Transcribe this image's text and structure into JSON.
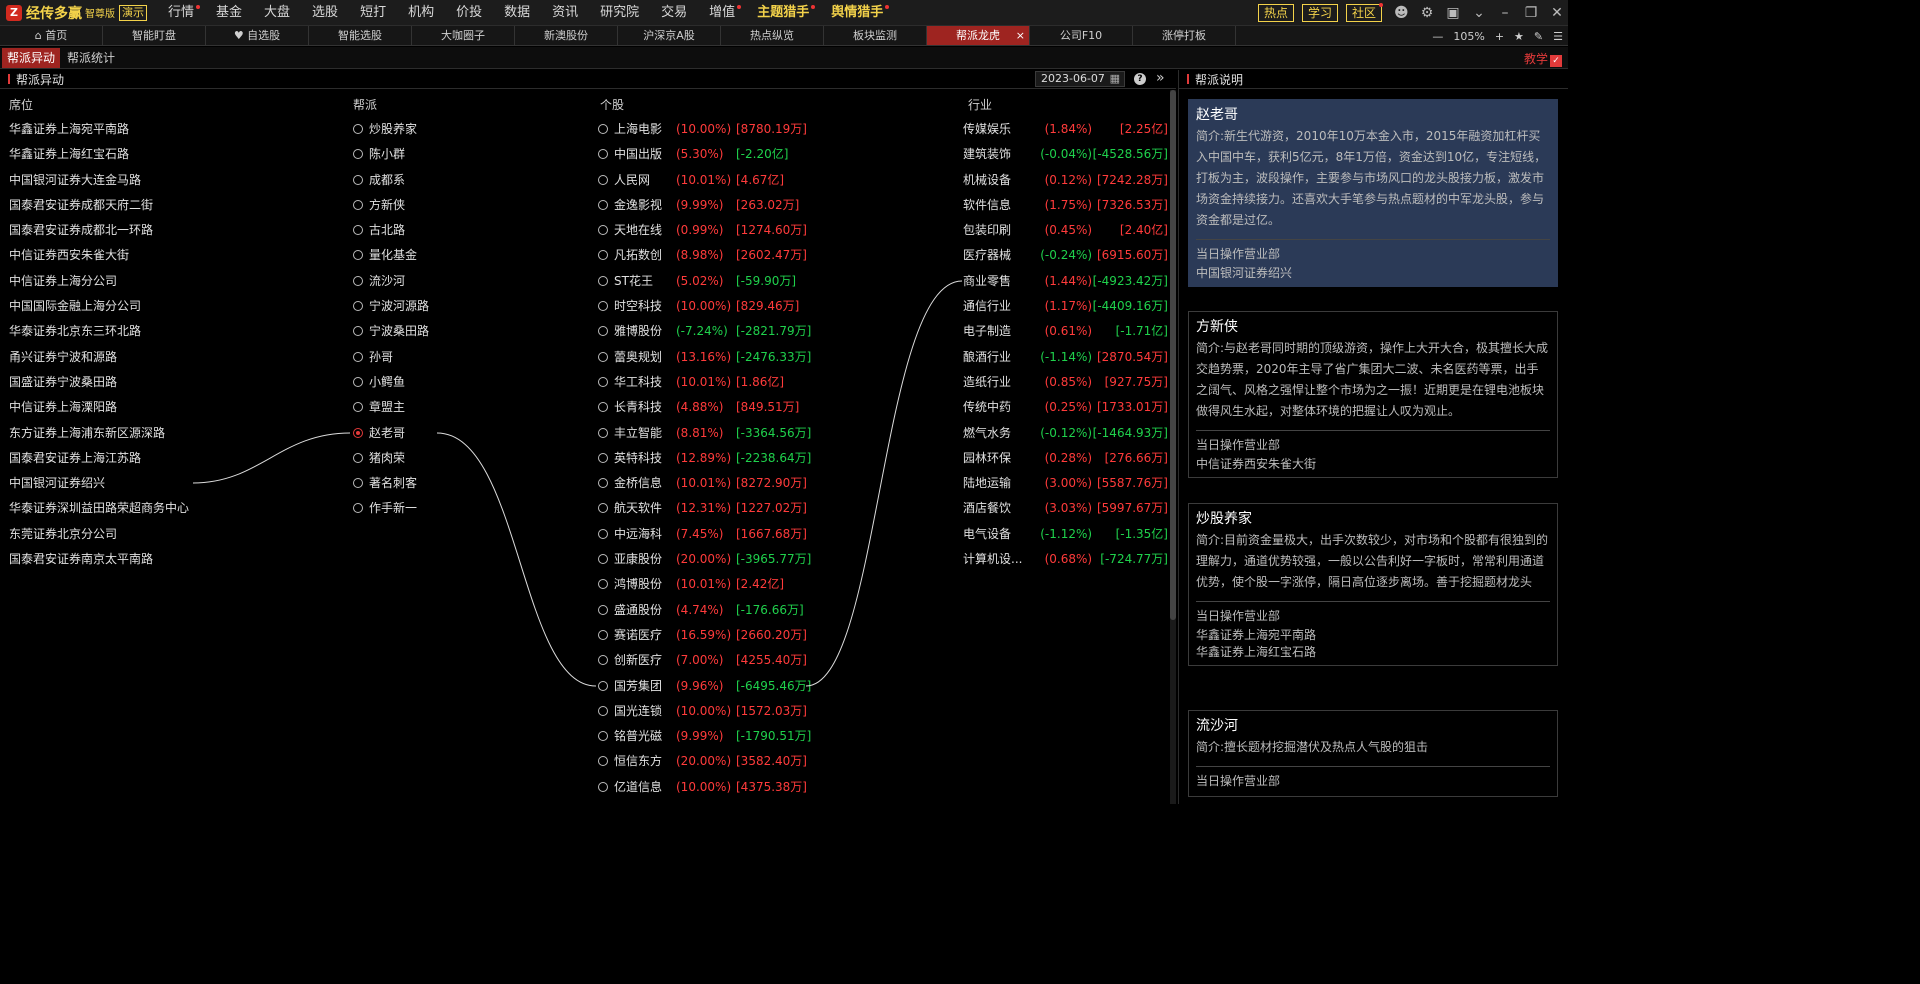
{
  "app": {
    "logo_text": "经传多赢",
    "edition": "智尊版",
    "demo_label": "演示",
    "menu": [
      {
        "label": "行情",
        "dot": true
      },
      {
        "label": "基金",
        "dot": false
      },
      {
        "label": "大盘",
        "dot": false
      },
      {
        "label": "选股",
        "dot": false
      },
      {
        "label": "短打",
        "dot": false
      },
      {
        "label": "机构",
        "dot": false
      },
      {
        "label": "价投",
        "dot": false
      },
      {
        "label": "数据",
        "dot": false
      },
      {
        "label": "资讯",
        "dot": false
      },
      {
        "label": "研究院",
        "dot": false
      },
      {
        "label": "交易",
        "dot": false
      },
      {
        "label": "增值",
        "dot": true
      },
      {
        "label": "主题猎手",
        "dot": true
      },
      {
        "label": "舆情猎手",
        "dot": true
      }
    ],
    "top_buttons": [
      "热点",
      "学习",
      "社区"
    ],
    "top_icons": [
      "user-icon",
      "gear-icon",
      "window-icon",
      "chevron-down-icon",
      "minimize-icon",
      "restore-icon",
      "close-icon"
    ]
  },
  "tabs": [
    {
      "label": "首页"
    },
    {
      "label": "智能盯盘"
    },
    {
      "label": "自选股"
    },
    {
      "label": "智能选股"
    },
    {
      "label": "大咖圈子"
    },
    {
      "label": "新澳股份"
    },
    {
      "label": "沪深京A股"
    },
    {
      "label": "热点纵览"
    },
    {
      "label": "板块监测"
    },
    {
      "label": "帮派龙虎",
      "active": true
    },
    {
      "label": "公司F10"
    },
    {
      "label": "涨停打板"
    }
  ],
  "zoom": {
    "minus": "—",
    "value": "105%",
    "plus": "+"
  },
  "subtabs": [
    "帮派异动",
    "帮派统计"
  ],
  "teach_label": "教学",
  "left_panel": {
    "title": "帮派异动",
    "date": "2023-06-07",
    "headers": {
      "seat": "席位",
      "faction": "帮派",
      "stock": "个股",
      "industry": "行业"
    },
    "seats": [
      "华鑫证券上海宛平南路",
      "华鑫证券上海红宝石路",
      "中国银河证券大连金马路",
      "国泰君安证券成都天府二街",
      "国泰君安证券成都北一环路",
      "中信证券西安朱雀大街",
      "中信证券上海分公司",
      "中国国际金融上海分公司",
      "华泰证券北京东三环北路",
      "甬兴证券宁波和源路",
      "国盛证券宁波桑田路",
      "中信证券上海溧阳路",
      "东方证券上海浦东新区源深路",
      "国泰君安证券上海江苏路",
      "中国银河证券绍兴",
      "华泰证券深圳益田路荣超商务中心",
      "东莞证券北京分公司",
      "国泰君安证券南京太平南路"
    ],
    "factions": [
      {
        "name": "炒股养家"
      },
      {
        "name": "陈小群"
      },
      {
        "name": "成都系"
      },
      {
        "name": "方新侠"
      },
      {
        "name": "古北路"
      },
      {
        "name": "量化基金"
      },
      {
        "name": "流沙河"
      },
      {
        "name": "宁波河源路"
      },
      {
        "name": "宁波桑田路"
      },
      {
        "name": "孙哥"
      },
      {
        "name": "小鳄鱼"
      },
      {
        "name": "章盟主"
      },
      {
        "name": "赵老哥",
        "selected": true
      },
      {
        "name": "猪肉荣"
      },
      {
        "name": "著名刺客"
      },
      {
        "name": "作手新一"
      }
    ],
    "stocks": [
      {
        "name": "上海电影",
        "pct": "(10.00%)",
        "amt": "[8780.19万]",
        "pc": "red",
        "ac": "red"
      },
      {
        "name": "中国出版",
        "pct": "(5.30%)",
        "amt": "[-2.20亿]",
        "pc": "red",
        "ac": "green"
      },
      {
        "name": "人民网",
        "pct": "(10.01%)",
        "amt": "[4.67亿]",
        "pc": "red",
        "ac": "red"
      },
      {
        "name": "金逸影视",
        "pct": "(9.99%)",
        "amt": "[263.02万]",
        "pc": "red",
        "ac": "red"
      },
      {
        "name": "天地在线",
        "pct": "(0.99%)",
        "amt": "[1274.60万]",
        "pc": "red",
        "ac": "red"
      },
      {
        "name": "凡拓数创",
        "pct": "(8.98%)",
        "amt": "[2602.47万]",
        "pc": "red",
        "ac": "red"
      },
      {
        "name": "ST花王",
        "pct": "(5.02%)",
        "amt": "[-59.90万]",
        "pc": "red",
        "ac": "green"
      },
      {
        "name": "时空科技",
        "pct": "(10.00%)",
        "amt": "[829.46万]",
        "pc": "red",
        "ac": "red"
      },
      {
        "name": "雅博股份",
        "pct": "(-7.24%)",
        "amt": "[-2821.79万]",
        "pc": "green",
        "ac": "green"
      },
      {
        "name": "蕾奥规划",
        "pct": "(13.16%)",
        "amt": "[-2476.33万]",
        "pc": "red",
        "ac": "green"
      },
      {
        "name": "华工科技",
        "pct": "(10.01%)",
        "amt": "[1.86亿]",
        "pc": "red",
        "ac": "red"
      },
      {
        "name": "长青科技",
        "pct": "(4.88%)",
        "amt": "[849.51万]",
        "pc": "red",
        "ac": "red"
      },
      {
        "name": "丰立智能",
        "pct": "(8.81%)",
        "amt": "[-3364.56万]",
        "pc": "red",
        "ac": "green"
      },
      {
        "name": "英特科技",
        "pct": "(12.89%)",
        "amt": "[-2238.64万]",
        "pc": "red",
        "ac": "green"
      },
      {
        "name": "金桥信息",
        "pct": "(10.01%)",
        "amt": "[8272.90万]",
        "pc": "red",
        "ac": "red"
      },
      {
        "name": "航天软件",
        "pct": "(12.31%)",
        "amt": "[1227.02万]",
        "pc": "red",
        "ac": "red"
      },
      {
        "name": "中远海科",
        "pct": "(7.45%)",
        "amt": "[1667.68万]",
        "pc": "red",
        "ac": "red"
      },
      {
        "name": "亚康股份",
        "pct": "(20.00%)",
        "amt": "[-3965.77万]",
        "pc": "red",
        "ac": "green"
      },
      {
        "name": "鸿博股份",
        "pct": "(10.01%)",
        "amt": "[2.42亿]",
        "pc": "red",
        "ac": "red"
      },
      {
        "name": "盛通股份",
        "pct": "(4.74%)",
        "amt": "[-176.66万]",
        "pc": "red",
        "ac": "green"
      },
      {
        "name": "赛诺医疗",
        "pct": "(16.59%)",
        "amt": "[2660.20万]",
        "pc": "red",
        "ac": "red"
      },
      {
        "name": "创新医疗",
        "pct": "(7.00%)",
        "amt": "[4255.40万]",
        "pc": "red",
        "ac": "red"
      },
      {
        "name": "国芳集团",
        "pct": "(9.96%)",
        "amt": "[-6495.46万]",
        "pc": "red",
        "ac": "green"
      },
      {
        "name": "国光连锁",
        "pct": "(10.00%)",
        "amt": "[1572.03万]",
        "pc": "red",
        "ac": "red"
      },
      {
        "name": "铭普光磁",
        "pct": "(9.99%)",
        "amt": "[-1790.51万]",
        "pc": "red",
        "ac": "green"
      },
      {
        "name": "恒信东方",
        "pct": "(20.00%)",
        "amt": "[3582.40万]",
        "pc": "red",
        "ac": "red"
      },
      {
        "name": "亿道信息",
        "pct": "(10.00%)",
        "amt": "[4375.38万]",
        "pc": "red",
        "ac": "red"
      }
    ],
    "industries": [
      {
        "name": "传媒娱乐",
        "pct": "(1.84%)",
        "amt": "[2.25亿]",
        "pc": "red",
        "ac": "red"
      },
      {
        "name": "建筑装饰",
        "pct": "(-0.04%)",
        "amt": "[-4528.56万]",
        "pc": "green",
        "ac": "green"
      },
      {
        "name": "机械设备",
        "pct": "(0.12%)",
        "amt": "[7242.28万]",
        "pc": "red",
        "ac": "red"
      },
      {
        "name": "软件信息",
        "pct": "(1.75%)",
        "amt": "[7326.53万]",
        "pc": "red",
        "ac": "red"
      },
      {
        "name": "包装印刷",
        "pct": "(0.45%)",
        "amt": "[2.40亿]",
        "pc": "red",
        "ac": "red"
      },
      {
        "name": "医疗器械",
        "pct": "(-0.24%)",
        "amt": "[6915.60万]",
        "pc": "green",
        "ac": "red"
      },
      {
        "name": "商业零售",
        "pct": "(1.44%)",
        "amt": "[-4923.42万]",
        "pc": "red",
        "ac": "green"
      },
      {
        "name": "通信行业",
        "pct": "(1.17%)",
        "amt": "[-4409.16万]",
        "pc": "red",
        "ac": "green"
      },
      {
        "name": "电子制造",
        "pct": "(0.61%)",
        "amt": "[-1.71亿]",
        "pc": "red",
        "ac": "green"
      },
      {
        "name": "酿酒行业",
        "pct": "(-1.14%)",
        "amt": "[2870.54万]",
        "pc": "green",
        "ac": "red"
      },
      {
        "name": "造纸行业",
        "pct": "(0.85%)",
        "amt": "[927.75万]",
        "pc": "red",
        "ac": "red"
      },
      {
        "name": "传统中药",
        "pct": "(0.25%)",
        "amt": "[1733.01万]",
        "pc": "red",
        "ac": "red"
      },
      {
        "name": "燃气水务",
        "pct": "(-0.12%)",
        "amt": "[-1464.93万]",
        "pc": "green",
        "ac": "green"
      },
      {
        "name": "园林环保",
        "pct": "(0.28%)",
        "amt": "[276.66万]",
        "pc": "red",
        "ac": "red"
      },
      {
        "name": "陆地运输",
        "pct": "(3.00%)",
        "amt": "[5587.76万]",
        "pc": "red",
        "ac": "red"
      },
      {
        "name": "酒店餐饮",
        "pct": "(3.03%)",
        "amt": "[5997.67万]",
        "pc": "red",
        "ac": "red"
      },
      {
        "name": "电气设备",
        "pct": "(-1.12%)",
        "amt": "[-1.35亿]",
        "pc": "green",
        "ac": "green"
      },
      {
        "name": "计算机设...",
        "pct": "(0.68%)",
        "amt": "[-724.77万]",
        "pc": "red",
        "ac": "green"
      }
    ]
  },
  "right_panel": {
    "title": "帮派说明",
    "cards": [
      {
        "name": "赵老哥",
        "desc": "简介:新生代游资，2010年10万本金入市，2015年融资加杠杆买入中国中车，获利5亿元，8年1万倍，资金达到10亿，专注短线，打板为主，波段操作，主要参与市场风口的龙头股接力板，激发市场资金持续接力。还喜欢大手笔参与热点题材的中军龙头股，参与资金都是过亿。",
        "dept_label": "当日操作营业部",
        "seats": [
          "中国银河证券绍兴"
        ]
      },
      {
        "name": "方新侠",
        "desc": "简介:与赵老哥同时期的顶级游资，操作上大开大合，极其擅长大成交趋势票，2020年主导了省广集团大二波、未名医药等票，出手之阔气、风格之强悍让整个市场为之一振！近期更是在锂电池板块做得风生水起，对整体环境的把握让人叹为观止。",
        "dept_label": "当日操作营业部",
        "seats": [
          "中信证券西安朱雀大街"
        ]
      },
      {
        "name": "炒股养家",
        "desc": "简介:目前资金量极大，出手次数较少，对市场和个股都有很独到的理解力，通道优势较强，一般以公告利好一字板时，常常利用通道优势，使个股一字涨停，隔日高位逐步离场。善于挖掘题材龙头",
        "dept_label": "当日操作营业部",
        "seats": [
          "华鑫证券上海宛平南路",
          "华鑫证券上海红宝石路"
        ]
      },
      {
        "name": "流沙河",
        "desc": "简介:擅长题材挖掘潜伏及热点人气股的狙击",
        "dept_label": "当日操作营业部",
        "seats": []
      }
    ]
  }
}
